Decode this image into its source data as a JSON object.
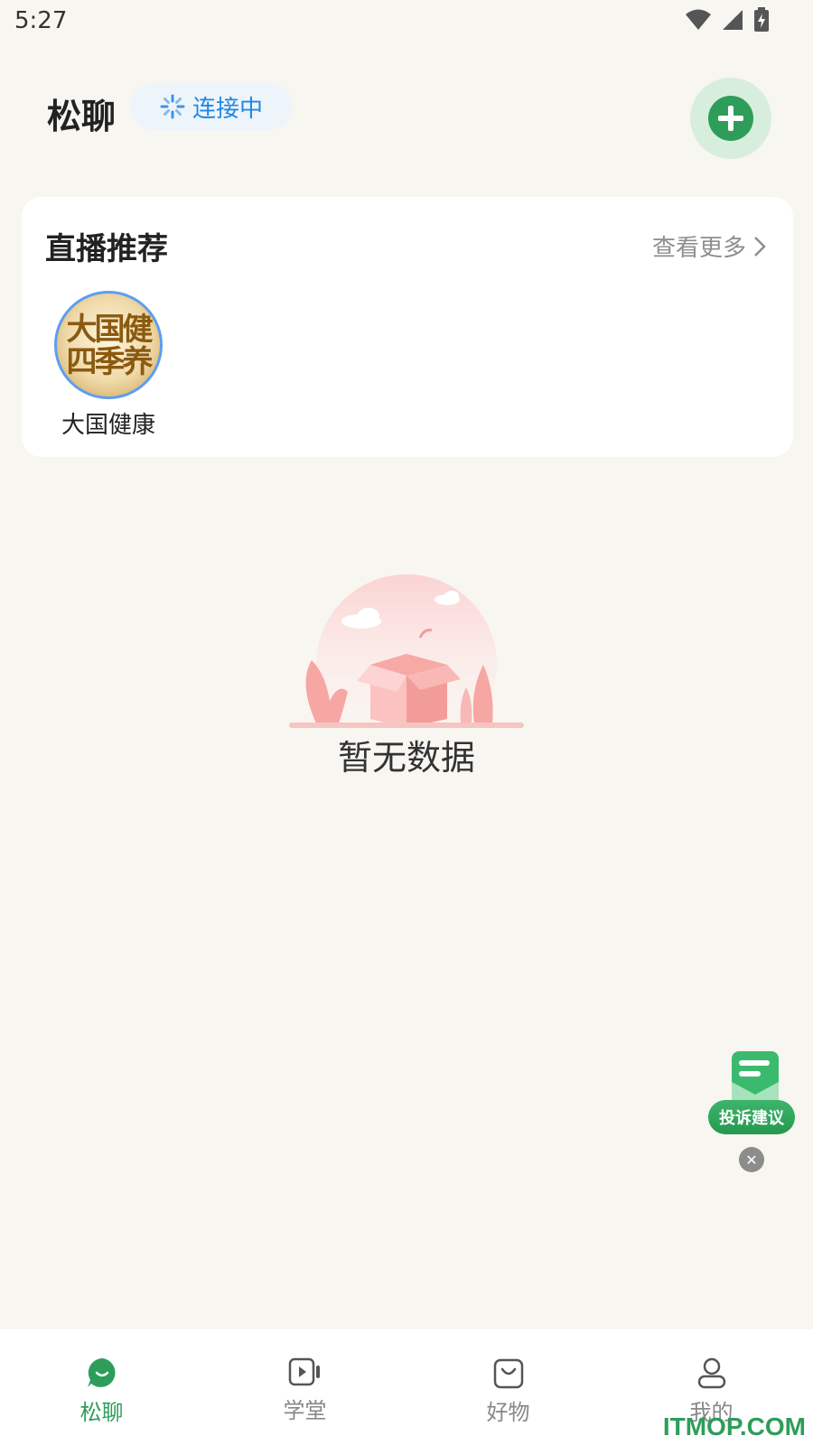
{
  "status_bar": {
    "time": "5:27"
  },
  "header": {
    "title": "松聊",
    "connection_status": "连接中"
  },
  "live_section": {
    "title": "直播推荐",
    "view_more": "查看更多",
    "items": [
      {
        "name": "大国健康",
        "avatar_text": "大国健康\n四季养生"
      }
    ]
  },
  "empty_state": {
    "message": "暂无数据"
  },
  "complaint_float": {
    "label": "投诉建议"
  },
  "tab_bar": {
    "tabs": [
      {
        "label": "松聊",
        "icon": "chat-bubble-icon",
        "active": true
      },
      {
        "label": "学堂",
        "icon": "video-play-icon",
        "active": false
      },
      {
        "label": "好物",
        "icon": "shopping-bag-icon",
        "active": false
      },
      {
        "label": "我的",
        "icon": "user-icon",
        "active": false
      }
    ]
  },
  "watermark": "ITMOP.COM",
  "colors": {
    "accent_green": "#2E9D5A",
    "connection_blue": "#1E88E5",
    "background": "#F8F6F1"
  }
}
